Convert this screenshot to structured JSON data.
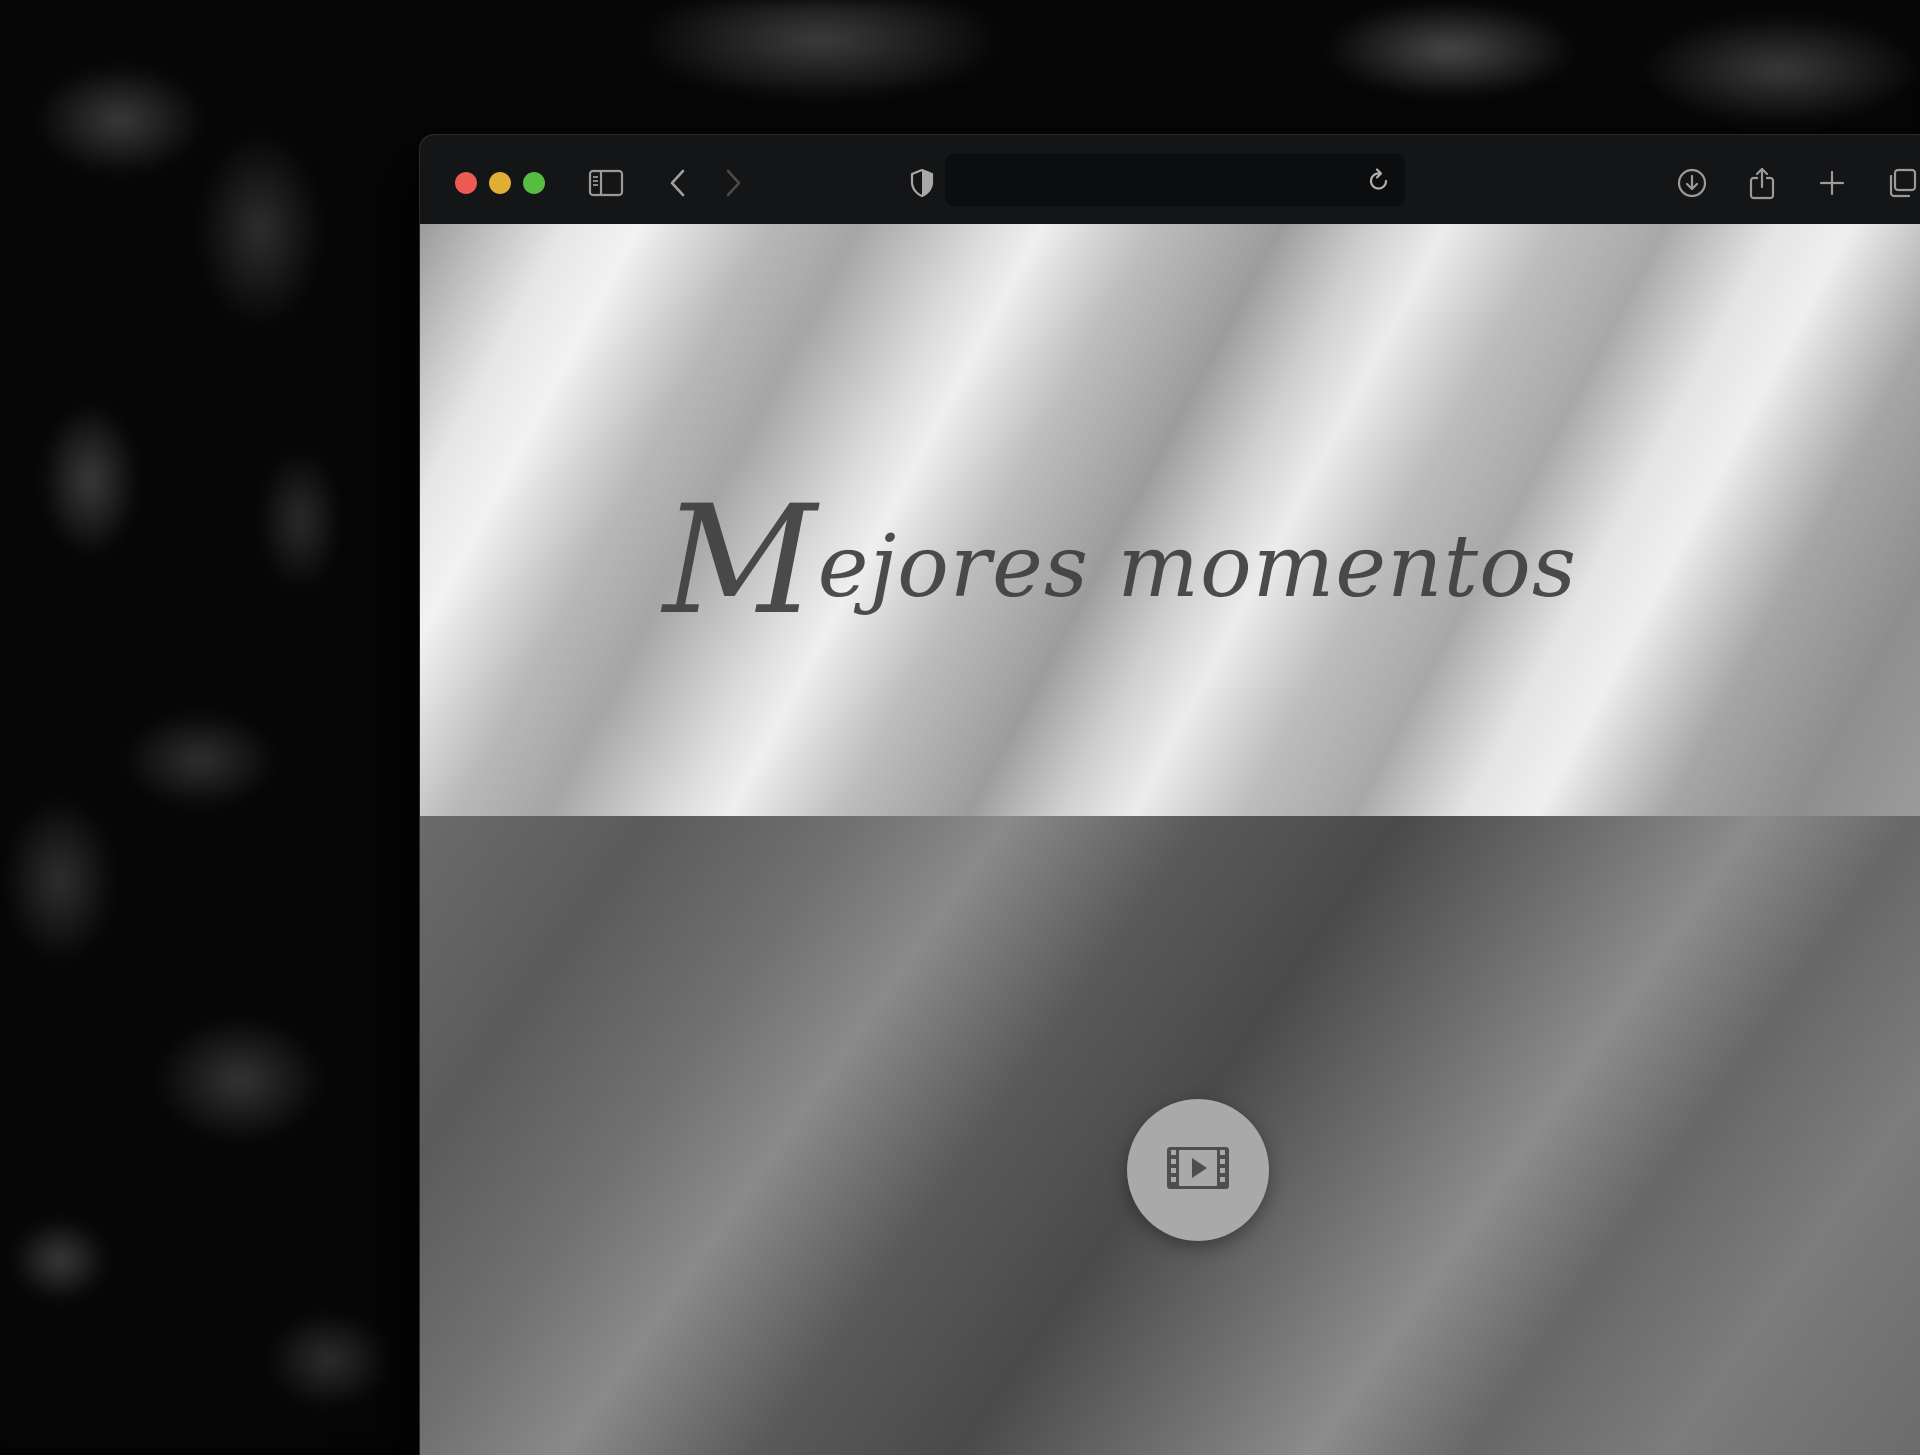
{
  "browser": {
    "address_bar": {
      "value": ""
    },
    "toolbar_icons": [
      "sidebar-icon",
      "back-icon",
      "forward-icon",
      "shield-icon",
      "reload-icon",
      "download-icon",
      "share-icon",
      "new-tab-icon",
      "tabs-overview-icon"
    ]
  },
  "page": {
    "hero": {
      "title_initial": "M",
      "title_rest": "ejores momentos"
    },
    "media": {
      "play_icon": "film-play-icon"
    }
  },
  "colors": {
    "close": "#ec5b52",
    "minimize": "#e0ae32",
    "zoom": "#57bd41",
    "toolbar_bg": "#141517",
    "title_text": "#3f3f3f"
  }
}
